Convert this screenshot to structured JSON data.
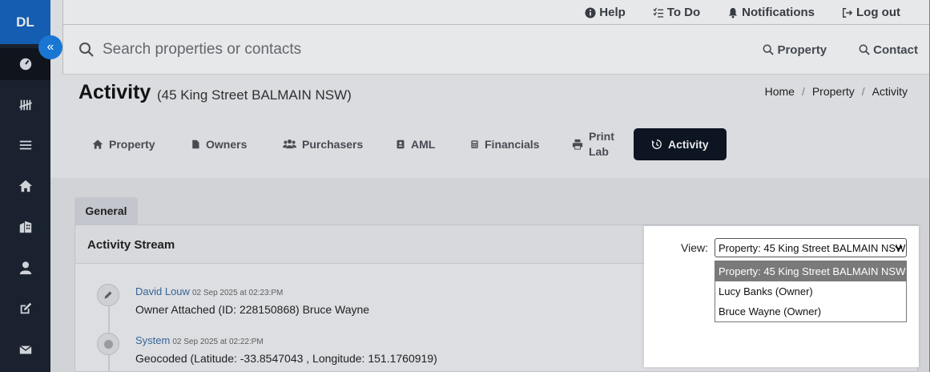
{
  "app": {
    "logo_text": "DL"
  },
  "sidebar": {
    "items": [
      {
        "icon": "dashboard-icon",
        "active": true
      },
      {
        "icon": "tally-icon"
      },
      {
        "icon": "list-icon"
      },
      {
        "icon": "home-icon"
      },
      {
        "icon": "building-icon"
      },
      {
        "icon": "user-icon"
      },
      {
        "icon": "edit-icon"
      },
      {
        "icon": "mail-icon"
      }
    ],
    "collapse_label": "«"
  },
  "topbar": {
    "help": "Help",
    "todo": "To Do",
    "notifications": "Notifications",
    "logout": "Log out"
  },
  "search": {
    "placeholder": "Search properties or contacts",
    "property_label": "Property",
    "contact_label": "Contact"
  },
  "page": {
    "title": "Activity",
    "subtitle": "(45 King Street BALMAIN NSW)"
  },
  "breadcrumb": {
    "items": [
      "Home",
      "Property",
      "Activity"
    ]
  },
  "tabs": [
    {
      "label": "Property",
      "icon": "home-icon"
    },
    {
      "label": "Owners",
      "icon": "document-icon"
    },
    {
      "label": "Purchasers",
      "icon": "users-icon"
    },
    {
      "label": "AML",
      "icon": "id-card-icon"
    },
    {
      "label": "Financials",
      "icon": "calculator-icon"
    },
    {
      "label": "Print Lab",
      "line1": "Print",
      "line2": "Lab",
      "icon": "printer-icon"
    },
    {
      "label": "Activity",
      "icon": "history-icon",
      "active": true
    }
  ],
  "general_tab": "General",
  "activity": {
    "panel_title": "Activity Stream",
    "view_label": "View:",
    "view_selected": "Property: 45 King Street BALMAIN NSW",
    "view_options": [
      "Property: 45 King Street BALMAIN NSW",
      "Lucy Banks (Owner)",
      "Bruce Wayne (Owner)"
    ],
    "entries": [
      {
        "author": "David Louw",
        "time": "02 Sep 2025 at 02:23:PM",
        "text": "Owner Attached (ID: 228150868) Bruce Wayne",
        "icon": "pencil-icon"
      },
      {
        "author": "System",
        "time": "02 Sep 2025 at 02:22:PM",
        "text": "Geocoded (Latitude: -33.8547043 , Longitude: 151.1760919)",
        "icon": "dot-icon"
      }
    ]
  },
  "colors": {
    "sidebar_bg": "#1b2330",
    "logo_bg": "#1565c0",
    "active_tab_bg": "#0d1522",
    "link": "#3a6ea5"
  }
}
